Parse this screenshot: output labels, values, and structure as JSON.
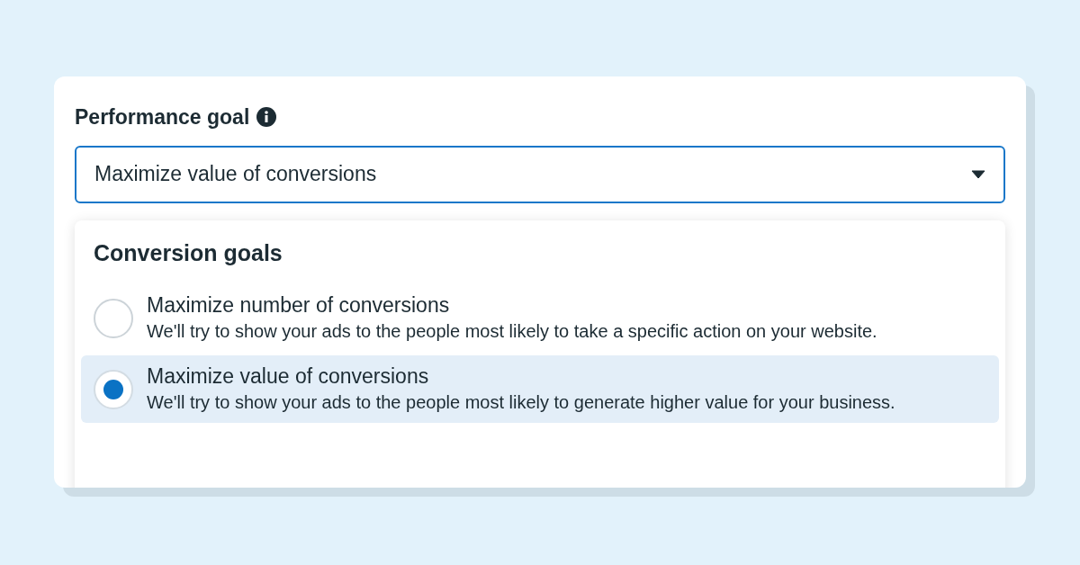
{
  "field": {
    "label": "Performance goal",
    "value": "Maximize value of conversions"
  },
  "menu": {
    "heading": "Conversion goals",
    "options": [
      {
        "title": "Maximize number of conversions",
        "description": "We'll try to show your ads to the people most likely to take a specific action on your website.",
        "selected": false
      },
      {
        "title": "Maximize value of conversions",
        "description": "We'll try to show your ads to the people most likely to generate higher value for your business.",
        "selected": true
      }
    ]
  }
}
